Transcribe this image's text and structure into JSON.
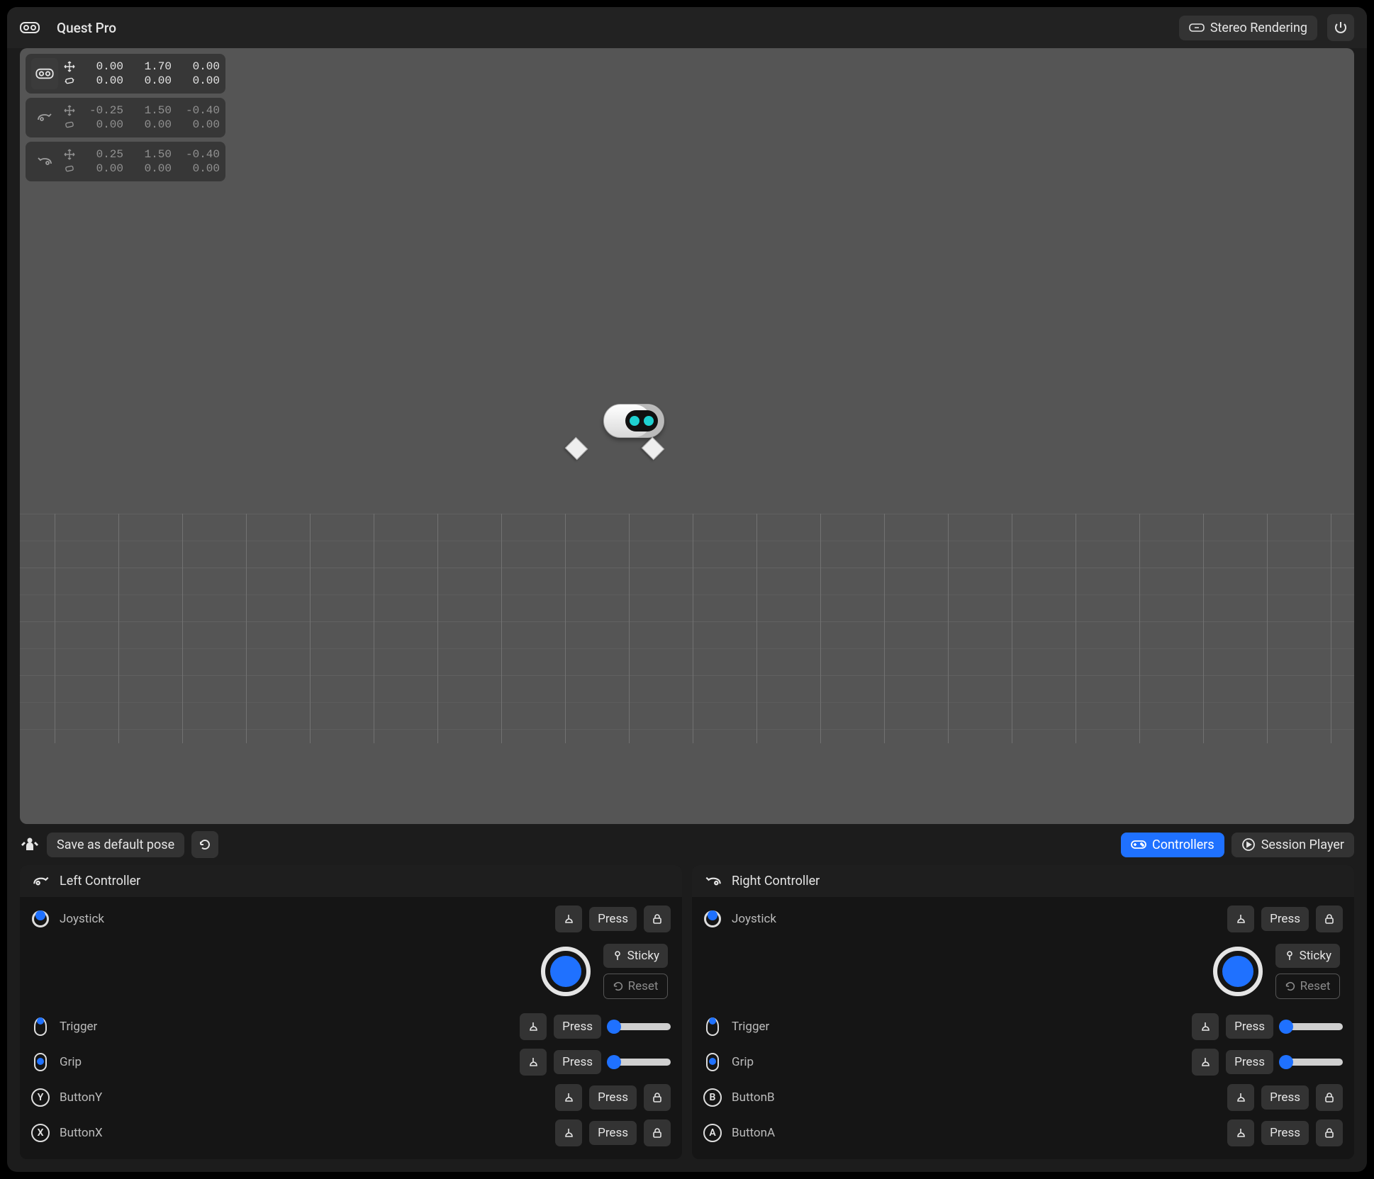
{
  "header": {
    "device_name": "Quest Pro",
    "stereo_btn": "Stereo Rendering"
  },
  "stats": [
    {
      "id": "headset",
      "active": true,
      "pos": [
        "0.00",
        "1.70",
        "0.00"
      ],
      "rot": [
        "0.00",
        "0.00",
        "0.00"
      ]
    },
    {
      "id": "left-controller",
      "active": false,
      "pos": [
        "-0.25",
        "1.50",
        "-0.40"
      ],
      "rot": [
        "0.00",
        "0.00",
        "0.00"
      ]
    },
    {
      "id": "right-controller",
      "active": false,
      "pos": [
        "0.25",
        "1.50",
        "-0.40"
      ],
      "rot": [
        "0.00",
        "0.00",
        "0.00"
      ]
    }
  ],
  "toolbar": {
    "save_pose": "Save as default pose",
    "tab_controllers": "Controllers",
    "tab_session": "Session Player"
  },
  "left": {
    "title": "Left Controller",
    "joystick": "Joystick",
    "press": "Press",
    "sticky": "Sticky",
    "reset": "Reset",
    "trigger": "Trigger",
    "grip": "Grip",
    "buttonY": "ButtonY",
    "buttonX": "ButtonX",
    "letterY": "Y",
    "letterX": "X"
  },
  "right": {
    "title": "Right Controller",
    "joystick": "Joystick",
    "press": "Press",
    "sticky": "Sticky",
    "reset": "Reset",
    "trigger": "Trigger",
    "grip": "Grip",
    "buttonB": "ButtonB",
    "buttonA": "ButtonA",
    "letterB": "B",
    "letterA": "A"
  }
}
